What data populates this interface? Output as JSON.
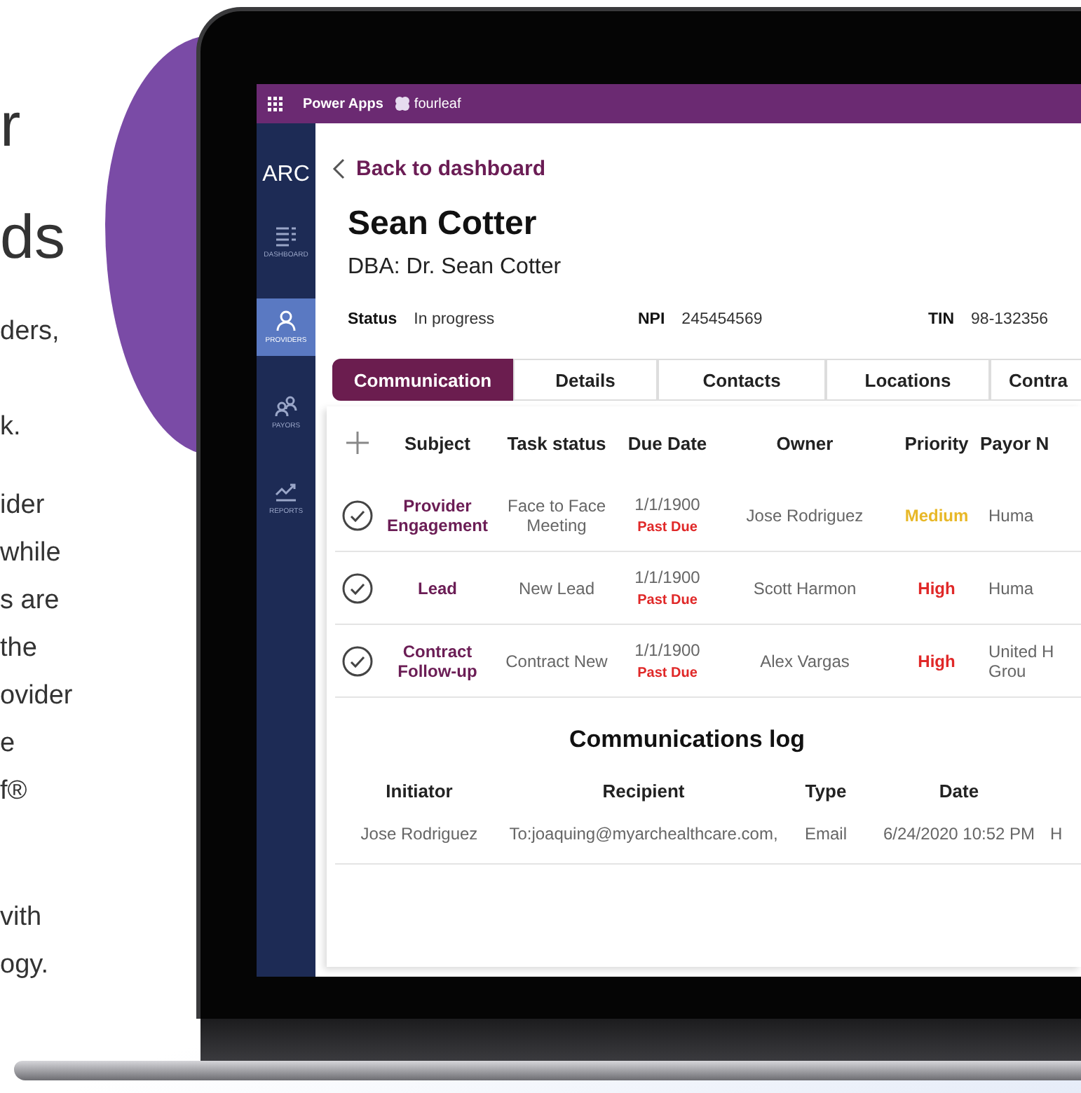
{
  "intro": {
    "headline_lines": [
      "r",
      "ds"
    ],
    "paragraphs": [
      [
        "ders,"
      ],
      [
        "k."
      ],
      [
        "ider",
        "while",
        "s are",
        "the",
        "ovider",
        "e",
        "f®"
      ],
      [
        "vith",
        "ogy."
      ]
    ]
  },
  "app": {
    "top_bar": {
      "title": "Power Apps",
      "brand": "fourleaf"
    },
    "sidebar": {
      "logo": "ARC",
      "items": [
        {
          "label": "DASHBOARD",
          "kind": "list",
          "selected": false
        },
        {
          "label": "PROVIDERS",
          "kind": "person",
          "selected": true
        },
        {
          "label": "PAYORS",
          "kind": "people",
          "selected": false
        },
        {
          "label": "REPORTS",
          "kind": "chart",
          "selected": false
        }
      ]
    },
    "back_link": "Back to dashboard",
    "name": "Sean Cotter",
    "dba": "DBA: Dr. Sean Cotter",
    "fields": [
      {
        "label": "Status",
        "value": "In progress"
      },
      {
        "label": "NPI",
        "value": "245454569"
      },
      {
        "label": "TIN",
        "value": "98-132356"
      }
    ],
    "tabs": [
      {
        "label": "Communication",
        "selected": true
      },
      {
        "label": "Details",
        "selected": false
      },
      {
        "label": "Contacts",
        "selected": false
      },
      {
        "label": "Locations",
        "selected": false
      },
      {
        "label": "Contra",
        "selected": false
      }
    ],
    "tasks": {
      "columns": [
        "Subject",
        "Task status",
        "Due Date",
        "Owner",
        "Priority",
        "Payor N"
      ],
      "rows": [
        {
          "subject": "Provider Engagement",
          "task_status": "Face to Face Meeting",
          "due_date": "1/1/1900",
          "due_note": "Past Due",
          "owner": "Jose Rodriguez",
          "priority": "Medium",
          "color": "#e8b828",
          "payor": [
            "Huma"
          ]
        },
        {
          "subject": "Lead",
          "task_status": "New Lead",
          "due_date": "1/1/1900",
          "due_note": "Past Due",
          "owner": "Scott Harmon",
          "priority": "High",
          "color": "#e02828",
          "payor": [
            "Huma"
          ]
        },
        {
          "subject": "Contract Follow-up",
          "task_status": "Contract New",
          "due_date": "1/1/1900",
          "due_note": "Past Due",
          "owner": "Alex Vargas",
          "priority": "High",
          "color": "#e02828",
          "payor": [
            "United H",
            "Grou"
          ]
        }
      ]
    },
    "log": {
      "title": "Communications log",
      "columns": [
        "Initiator",
        "Recipient",
        "Type",
        "Date"
      ],
      "rows": [
        {
          "cells": [
            "Jose Rodriguez",
            "To:joaquing@myarchealthcare.com,",
            "Email",
            "6/24/2020 10:52 PM",
            "H"
          ]
        }
      ]
    }
  }
}
